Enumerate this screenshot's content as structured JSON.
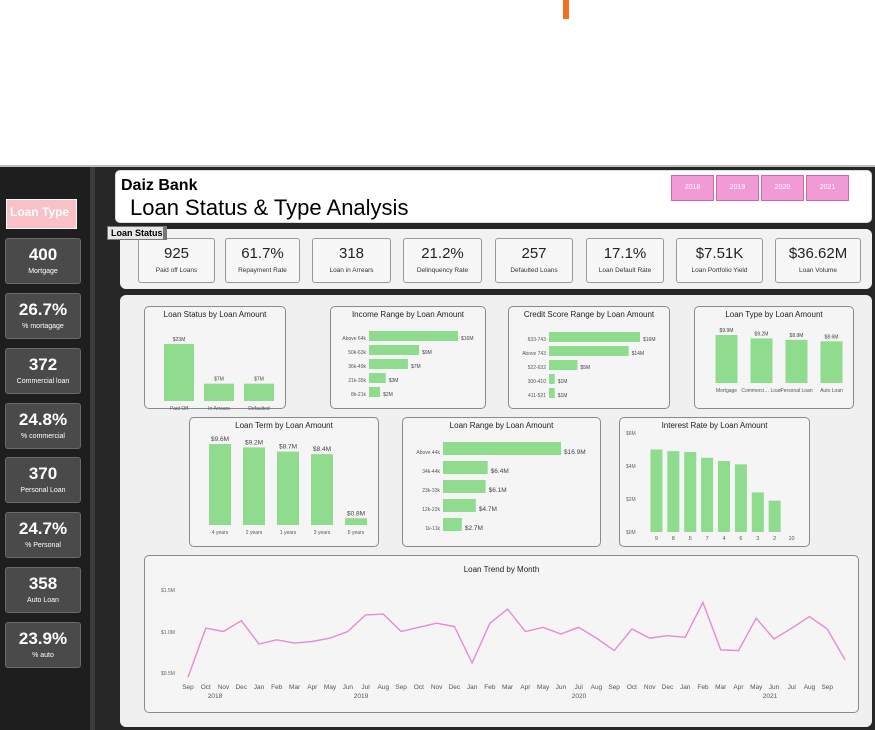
{
  "header": {
    "bank": "Daiz Bank",
    "title": "Loan Status & Type Analysis"
  },
  "years": [
    "2018",
    "2019",
    "2020",
    "2021"
  ],
  "sidebar": {
    "slicer_title": "Loan Type",
    "kpis": [
      {
        "value": "400",
        "label": "Mortgage"
      },
      {
        "value": "26.7%",
        "label": "% mortagage"
      },
      {
        "value": "372",
        "label": "Commercial loan"
      },
      {
        "value": "24.8%",
        "label": "% commercial"
      },
      {
        "value": "370",
        "label": "Personal Loan"
      },
      {
        "value": "24.7%",
        "label": "% Personal"
      },
      {
        "value": "358",
        "label": "Auto Loan"
      },
      {
        "value": "23.9%",
        "label": "% auto"
      }
    ]
  },
  "status_tag": "Loan Status",
  "kpis": [
    {
      "value": "925",
      "label": "Paid off Loans"
    },
    {
      "value": "61.7%",
      "label": "Repayment Rate"
    },
    {
      "value": "318",
      "label": "Loan in Arrears"
    },
    {
      "value": "21.2%",
      "label": "Delinquency Rate"
    },
    {
      "value": "257",
      "label": "Defaulted Loans"
    },
    {
      "value": "17.1%",
      "label": "Loan Default Rate"
    },
    {
      "value": "$7.51K",
      "label": "Loan Portfolio Yield"
    },
    {
      "value": "$36.62M",
      "label": "Loan Volume"
    }
  ],
  "colors": {
    "bar": "#8fdc8f",
    "line": "#e88ad0",
    "year_button": "#f29ad6"
  },
  "chart_data": [
    {
      "type": "bar",
      "title": "Loan Status by Loan Amount",
      "categories": [
        "Paid Off",
        "In Arrears",
        "Defaulted"
      ],
      "values": [
        23,
        7,
        7
      ],
      "labels": [
        "$23M",
        "$7M",
        "$7M"
      ]
    },
    {
      "type": "bar",
      "orientation": "horizontal",
      "title": "Income Range by Loan Amount",
      "categories": [
        "Above 64k",
        "50k-63k",
        "36k-49k",
        "21k-35k",
        "8k-21k"
      ],
      "values": [
        16,
        9,
        7,
        3,
        2
      ],
      "labels": [
        "$16M",
        "$9M",
        "$7M",
        "$3M",
        "$2M"
      ]
    },
    {
      "type": "bar",
      "orientation": "horizontal",
      "title": "Credit Score Range by Loan Amount",
      "categories": [
        "633-743",
        "Above 743",
        "522-632",
        "300-410",
        "411-521"
      ],
      "values": [
        16,
        14,
        5,
        1,
        1
      ],
      "labels": [
        "$16M",
        "$14M",
        "$5M",
        "$1M",
        "$1M"
      ]
    },
    {
      "type": "bar",
      "title": "Loan Type by Loan Amount",
      "categories": [
        "Mortgage",
        "Commerci… Loan",
        "Personal Loan",
        "Auto Loan"
      ],
      "values": [
        9.9,
        9.2,
        8.9,
        8.6
      ],
      "labels": [
        "$9.9M",
        "$9.2M",
        "$8.9M",
        "$8.6M"
      ]
    },
    {
      "type": "bar",
      "title": "Loan Term by Loan Amount",
      "categories": [
        "4 years",
        "2 years",
        "1 years",
        "3 years",
        "5 years"
      ],
      "values": [
        9.6,
        9.2,
        8.7,
        8.4,
        0.8
      ],
      "labels": [
        "$9.6M",
        "$9.2M",
        "$8.7M",
        "$8.4M",
        "$0.8M"
      ]
    },
    {
      "type": "bar",
      "orientation": "horizontal",
      "title": "Loan Range by Loan Amount",
      "categories": [
        "Above 44k",
        "34k-44k",
        "23k-33k",
        "12k-22k",
        "1k-11k"
      ],
      "values": [
        16.9,
        6.4,
        6.1,
        4.7,
        2.7
      ],
      "labels": [
        "$16.9M",
        "$6.4M",
        "$6.1M",
        "$4.7M",
        "$2.7M"
      ]
    },
    {
      "type": "bar",
      "title": "Interest Rate by Loan Amount",
      "categories": [
        "9",
        "8",
        "5",
        "7",
        "4",
        "6",
        "3",
        "2",
        "10"
      ],
      "values": [
        5.0,
        4.9,
        4.85,
        4.5,
        4.3,
        4.1,
        2.4,
        1.9,
        0
      ],
      "yticks": [
        "$6M",
        "$4M",
        "$2M",
        "$0M"
      ],
      "ylim": [
        0,
        6
      ]
    },
    {
      "type": "line",
      "title": "Loan Trend by Month",
      "x": [
        "Sep",
        "Oct",
        "Nov",
        "Dec",
        "Jan",
        "Feb",
        "Mar",
        "Apr",
        "May",
        "Jun",
        "Jul",
        "Aug",
        "Sep",
        "Oct",
        "Nov",
        "Dec",
        "Jan",
        "Feb",
        "Mar",
        "Apr",
        "May",
        "Jun",
        "Jul",
        "Aug",
        "Sep",
        "Oct",
        "Nov",
        "Dec",
        "Jan",
        "Feb",
        "Mar",
        "Apr",
        "May",
        "Jun",
        "Jul",
        "Aug",
        "Sep"
      ],
      "year_labels": [
        "2018",
        "2019",
        "2020",
        "2021"
      ],
      "yticks": [
        "$1.5M",
        "$1.0M",
        "$0.5M"
      ],
      "ylim": [
        0.5,
        1.5
      ],
      "values": [
        0.45,
        1.04,
        1.0,
        1.13,
        0.85,
        0.9,
        0.86,
        0.88,
        0.92,
        1.0,
        1.2,
        1.21,
        1.0,
        1.05,
        1.1,
        1.06,
        0.62,
        1.1,
        1.27,
        1.0,
        1.05,
        0.97,
        1.05,
        0.92,
        0.77,
        1.03,
        0.92,
        0.95,
        0.93,
        1.35,
        0.78,
        0.77,
        1.16,
        0.91,
        1.04,
        1.18,
        1.03,
        0.66
      ]
    }
  ]
}
